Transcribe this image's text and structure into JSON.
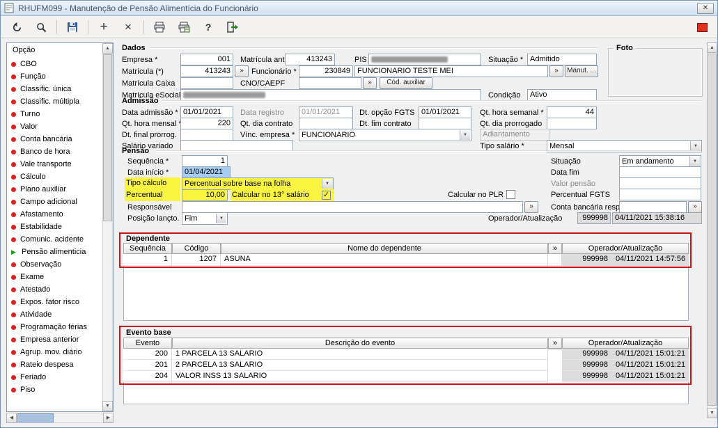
{
  "window": {
    "title": "RHUFM099 - Manutenção de Pensão Alimentícia do Funcionário"
  },
  "toolbar": {
    "icons": [
      "undo",
      "search",
      "save",
      "add",
      "delete",
      "print",
      "print-batch",
      "help",
      "exit",
      "record-indicator"
    ]
  },
  "sidebar": {
    "header": "Opção",
    "items": [
      {
        "label": "CBO"
      },
      {
        "label": "Função"
      },
      {
        "label": "Classific. única"
      },
      {
        "label": "Classific. múltipla"
      },
      {
        "label": "Turno"
      },
      {
        "label": "Valor"
      },
      {
        "label": "Conta bancária"
      },
      {
        "label": "Banco de hora"
      },
      {
        "label": "Vale transporte"
      },
      {
        "label": "Cálculo"
      },
      {
        "label": "Plano auxiliar"
      },
      {
        "label": "Campo adicional"
      },
      {
        "label": "Afastamento"
      },
      {
        "label": "Estabilidade"
      },
      {
        "label": "Comunic. acidente"
      },
      {
        "label": "Pensão alimenticia",
        "selected": true
      },
      {
        "label": "Observação"
      },
      {
        "label": "Exame"
      },
      {
        "label": "Atestado"
      },
      {
        "label": "Expos. fator risco"
      },
      {
        "label": "Atividade"
      },
      {
        "label": "Programação férias"
      },
      {
        "label": "Empresa anterior"
      },
      {
        "label": "Agrup. mov. diário"
      },
      {
        "label": "Rateio despesa"
      },
      {
        "label": "Feriado"
      },
      {
        "label": "Piso"
      }
    ]
  },
  "dados": {
    "title": "Dados",
    "empresa_label": "Empresa *",
    "empresa_value": "001",
    "matricula_anterior_label": "Matrícula anterior",
    "matricula_anterior_value": "413243",
    "pis_label": "PIS",
    "situacao_label": "Situação *",
    "situacao_value": "Admitido",
    "matricula_label": "Matrícula (*)",
    "matricula_value": "413243",
    "funcionario_label": "Funcionário *",
    "funcionario_code": "230849",
    "funcionario_nome": "FUNCIONARIO TESTE MEI",
    "lookup_button": "»",
    "manut_button": "Manut. ...",
    "matricula_caixa_label": "Matrícula Caixa",
    "matricula_caixa_value": "",
    "cno_caepf_label": "CNO/CAEPF",
    "cno_caepf_value": "",
    "cod_auxiliar_button": "Cód. auxiliar",
    "matricula_esocial_label": "Matrícula eSocial",
    "condicao_label": "Condição",
    "condicao_value": "Ativo",
    "foto_title": "Foto"
  },
  "admissao": {
    "title": "Admissão",
    "data_admissao_label": "Data admissão *",
    "data_admissao_value": "01/01/2021",
    "data_registro_label": "Data registro",
    "data_registro_value": "01/01/2021",
    "dt_opcao_fgts_label": "Dt. opção FGTS",
    "dt_opcao_fgts_value": "01/01/2021",
    "qt_hora_semanal_label": "Qt. hora semanal *",
    "qt_hora_semanal_value": "44",
    "qt_hora_mensal_label": "Qt. hora mensal *",
    "qt_hora_mensal_value": "220",
    "qt_dia_contrato_label": "Qt. dia contrato",
    "qt_dia_contrato_value": "",
    "dt_fim_contrato_label": "Dt. fim contrato",
    "dt_fim_contrato_value": "",
    "qt_dia_prorrogado_label": "Qt. dia prorrogado",
    "qt_dia_prorrogado_value": "",
    "dt_final_prorrog_label": "Dt. final prorrog.",
    "dt_final_prorrog_value": "",
    "vinc_empresa_label": "Vínc. empresa *",
    "vinc_empresa_value": "FUNCIONARIO",
    "adiantamento_label": "Adiantamento",
    "salario_variado_label": "Salário variado",
    "salario_variado_value": "",
    "tipo_salario_label": "Tipo salário *",
    "tipo_salario_value": "Mensal"
  },
  "pensao": {
    "title": "Pensão",
    "sequencia_label": "Sequência *",
    "sequencia_value": "1",
    "data_inicio_label": "Data início *",
    "data_inicio_value": "01/04/2021",
    "tipo_calculo_label": "Tipo cálculo",
    "tipo_calculo_value": "Percentual sobre base na folha",
    "percentual_label": "Percentual",
    "percentual_value": "10,00",
    "calc_13_label": "Calcular no 13° salário",
    "calc_13_checked": true,
    "calc_plr_label": "Calcular no PLR",
    "calc_plr_checked": false,
    "situacao_label": "Situação",
    "situacao_value": "Em andamento",
    "data_fim_label": "Data fim",
    "data_fim_value": "",
    "valor_pensao_label": "Valor pensão",
    "valor_pensao_value": "",
    "percentual_fgts_label": "Percentual FGTS",
    "percentual_fgts_value": "",
    "responsavel_label": "Responsável",
    "responsavel_value": "",
    "lookup_button": "»",
    "conta_bancaria_label": "Conta bancária resp.",
    "conta_bancaria_value": "",
    "posicao_lancto_label": "Posição lançto. *",
    "posicao_lancto_value": "Fim",
    "operador_label": "Operador/Atualização",
    "operador_code": "999998",
    "operador_data": "04/11/2021 15:38:16"
  },
  "dependente": {
    "title": "Dependente",
    "col_sequencia": "Sequência",
    "col_codigo": "Código",
    "col_nome": "Nome do dependente",
    "col_operador": "Operador/Atualização",
    "lookup_button": "»",
    "rows": [
      {
        "sequencia": "1",
        "codigo": "1207",
        "nome": "ASUNA",
        "operador": "999998",
        "atualizacao": "04/11/2021 14:57:56"
      }
    ]
  },
  "evento_base": {
    "title": "Evento base",
    "col_evento": "Evento",
    "col_descricao": "Descrição do evento",
    "col_operador": "Operador/Atualização",
    "lookup_button": "»",
    "rows": [
      {
        "evento": "200",
        "descricao": "1 PARCELA 13 SALARIO",
        "operador": "999998",
        "atualizacao": "04/11/2021 15:01:21"
      },
      {
        "evento": "201",
        "descricao": "2 PARCELA 13 SALARIO",
        "operador": "999998",
        "atualizacao": "04/11/2021 15:01:21"
      },
      {
        "evento": "204",
        "descricao": "VALOR INSS 13 SALARIO",
        "operador": "999998",
        "atualizacao": "04/11/2021 15:01:21"
      }
    ]
  },
  "colors": {
    "highlight": "#f8f440",
    "annotation": "#c81414",
    "selection": "#a6ccf2",
    "status_red": "#e03020"
  }
}
